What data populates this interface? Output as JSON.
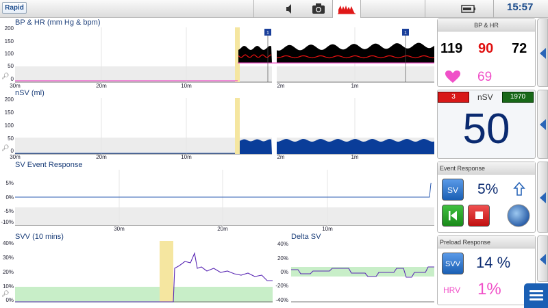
{
  "topbar": {
    "brand": "Rapid",
    "time": "15:57",
    "icons": [
      "speaker-icon",
      "camera-icon",
      "waveform-icon",
      "battery-icon"
    ]
  },
  "plots": {
    "bp_hr": {
      "title": "BP & HR (mm Hg & bpm)",
      "yticks": [
        "200",
        "150",
        "100",
        "50",
        "0"
      ],
      "xticks_left": [
        "30m",
        "20m",
        "10m"
      ],
      "xticks_right": [
        "2m",
        "1m"
      ],
      "markers": [
        "1",
        "1"
      ]
    },
    "nsv": {
      "title": "nSV (ml)",
      "yticks": [
        "200",
        "150",
        "100",
        "50",
        "0"
      ],
      "xticks_left": [
        "30m",
        "20m",
        "10m"
      ],
      "xticks_right": [
        "2m",
        "1m"
      ]
    },
    "sv_event": {
      "title": "SV Event Response",
      "yticks": [
        "5%",
        "0%",
        "-5%",
        "-10%"
      ],
      "xticks": [
        "30m",
        "20m",
        "10m"
      ]
    },
    "svv": {
      "title": "SVV (10 mins)",
      "yticks": [
        "40%",
        "30%",
        "20%",
        "10%",
        "0%"
      ]
    },
    "delta_sv": {
      "title": "Delta SV",
      "yticks": [
        "40%",
        "20%",
        "0%",
        "-20%",
        "-40%"
      ]
    }
  },
  "panels": {
    "bp_hr": {
      "header": "BP & HR",
      "sys": "119",
      "dia": "90",
      "map": "72",
      "hr": "69",
      "colors": {
        "sys": "#000000",
        "dia": "#e01010",
        "map": "#000000",
        "hr": "#f050c8"
      }
    },
    "nsv": {
      "label": "nSV",
      "low": "3",
      "high": "1970",
      "value": "50"
    },
    "event": {
      "header": "Event Response",
      "sv_label": "SV",
      "sv_value": "5%"
    },
    "preload": {
      "header": "Preload Response",
      "svv_label": "SVV",
      "svv_value": "14 %",
      "hrv_label": "HRV",
      "hrv_value": "1%"
    }
  },
  "colors": {
    "accent": "#1a5fb4",
    "title_blue": "#1c3f7a",
    "green_zone": "#c8eec8",
    "event_marker": "#f5e6a0",
    "bp_red": "#e01010",
    "bp_black": "#000000",
    "sv_blue": "#0a3d99",
    "svv_purple": "#5a28b4",
    "hr_pink": "#f050c8"
  }
}
